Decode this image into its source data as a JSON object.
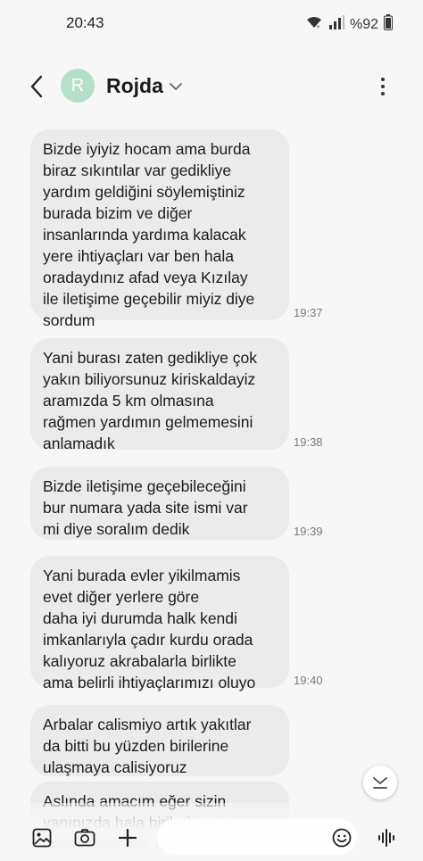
{
  "status": {
    "time": "20:43",
    "battery": "%92"
  },
  "header": {
    "avatar_letter": "R",
    "contact_name": "Rojda"
  },
  "messages": [
    {
      "text": "Bizde iyiyiz hocam ama burda\nbiraz sıkıntılar var gedikliye\nyardım geldiğini söylemiştiniz\nburada bizim ve diğer\ninsanlarında yardıma kalacak\nyere ihtiyaçları var ben hala\noradaydınız afad veya Kızılay\nile iletişime geçebilir miyiz diye\nsordum",
      "time": "19:37"
    },
    {
      "text": "Yani burası zaten gedikliye çok\nyakın biliyorsunuz kiriskaldayiz\naramızda 5 km olmasına\nrağmen yardımın gelmemesini\nanlamadık",
      "time": "19:38"
    },
    {
      "text": "Bizde iletişime geçebileceğini\nbur numara yada site ismi var\nmi diye soralım dedik",
      "time": "19:39"
    },
    {
      "text": "Yani burada evler yikilmamis\nevet diğer yerlere  göre\ndaha iyi durumda halk kendi\nimkanlarıyla çadır kurdu orada\nkalıyoruz akrabalarla birlikte\nama belirli ihtiyaçlarımızı oluyo",
      "time": "19:40"
    },
    {
      "text": "Arbalar calismiyo artık yakıtlar\nda bitti bu yüzden birilerine\nulaşmaya calisiyoruz",
      "time": ""
    },
    {
      "text": "Aslında amacım eğer sizin\nyanınızda hala birileri varsa\nonlarla iletişime geçebilir\nsöylemenizi istedim",
      "time": ""
    }
  ],
  "icons": {
    "back": "chevron-left-icon",
    "chevron": "chevron-down-icon",
    "more": "more-vertical-icon",
    "scroll": "scroll-down-icon",
    "gallery": "image-icon",
    "camera": "camera-icon",
    "add": "plus-icon",
    "emoji": "emoji-icon",
    "voice": "voice-wave-icon"
  },
  "colors": {
    "background": "#f7f7f7",
    "bubble": "#ebebeb",
    "avatar": "#b4e0c9"
  }
}
